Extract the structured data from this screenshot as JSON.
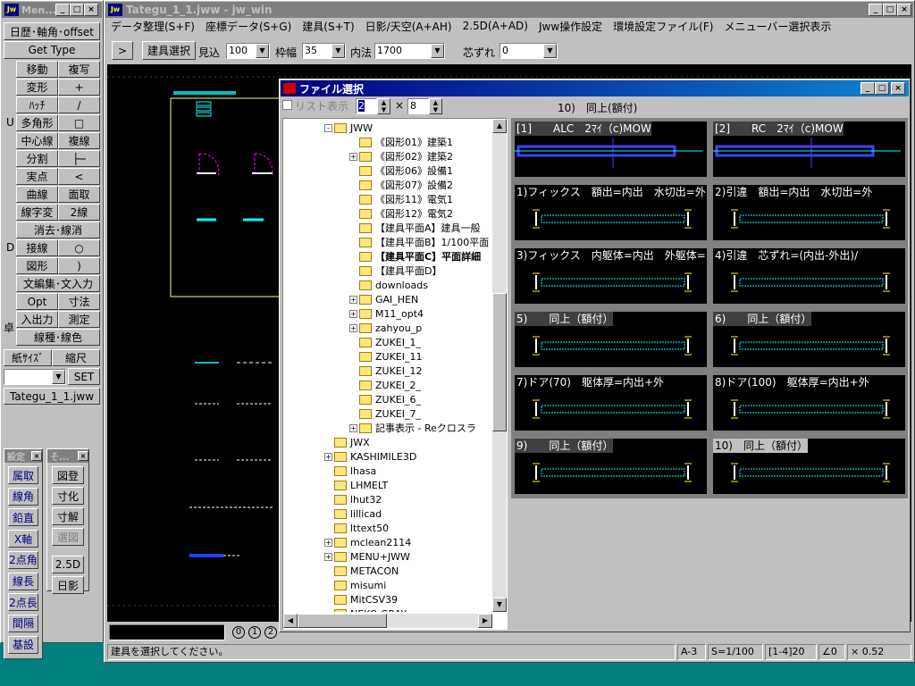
{
  "side": {
    "title": "Men...",
    "row1": "日歴･軸角･offset",
    "gettype": "Get Type",
    "tools": [
      [
        "移動",
        "複写"
      ],
      [
        "変形",
        "+"
      ],
      [
        "ﾊｯﾁ",
        "/"
      ],
      [
        "多角形",
        "□"
      ],
      [
        "中心線",
        "複線"
      ],
      [
        "分割",
        "├─"
      ],
      [
        "実点",
        "<"
      ],
      [
        "曲線",
        "面取"
      ],
      [
        "線字変",
        "2線"
      ],
      [
        "消去･線消",
        ""
      ],
      [
        "接線",
        "○"
      ],
      [
        "図形",
        ")"
      ],
      [
        "文編集･文入力",
        ""
      ],
      [
        "Opt",
        "寸法"
      ],
      [
        "入出力",
        "測定"
      ],
      [
        "線種･線色",
        ""
      ]
    ],
    "letters": [
      "U",
      "D",
      "卓"
    ],
    "paper": "紙ｻｲｽﾞ",
    "scale": "縮尺",
    "set": "SET",
    "file": "Tategu_1_1.jww",
    "sp1_title": "設定",
    "sp1": [
      "属取",
      "線角",
      "鉛直",
      "X軸",
      "2点角",
      "線長",
      "2点長",
      "間隔",
      "基設"
    ],
    "sp2_title": "そ...",
    "sp2": [
      "図登",
      "寸化",
      "寸解",
      "選図",
      "2.5D",
      "日影"
    ]
  },
  "main": {
    "title": "Tategu_1_1.jww - jw_win",
    "menu": [
      "データ整理(S+F)",
      "座標データ(S+G)",
      "建具(S+T)",
      "日影/天空(A+AH)",
      "2.5D(A+AD)",
      "Jww操作設定",
      "環境設定ファイル(F)",
      "メニューバー選択表示"
    ],
    "tb": {
      "arrow": ">",
      "sel": "建具選択",
      "mikomi": "見込",
      "mikomi_v": "100",
      "waku": "枠幅",
      "waku_v": "35",
      "uchi": "内法",
      "uchi_v": "1700",
      "shin": "芯ずれ",
      "shin_v": "0"
    },
    "circles": [
      "0",
      "1",
      "2"
    ],
    "status": {
      "msg": "建具を選択してください。",
      "paper": "A-3",
      "scale": "S=1/100",
      "layer": "[1-4]20",
      "angle": "∠0",
      "ratio": "× 0.52"
    }
  },
  "dlg": {
    "title": "ファイル選択",
    "list_label": "リスト表示",
    "cols": "2",
    "x": "×",
    "rows": "8",
    "selected": "10)　同上(額付)",
    "tree": [
      {
        "t": "JWW",
        "lv": 1,
        "exp": "-"
      },
      {
        "t": "《図形01》建築1",
        "lv": 2
      },
      {
        "t": "《図形02》建築2",
        "lv": 2,
        "exp": "+"
      },
      {
        "t": "《図形06》設備1",
        "lv": 2
      },
      {
        "t": "《図形07》設備2",
        "lv": 2
      },
      {
        "t": "《図形11》電気1",
        "lv": 2
      },
      {
        "t": "《図形12》電気2",
        "lv": 2
      },
      {
        "t": "【建具平面A】建具一般",
        "lv": 2
      },
      {
        "t": "【建具平面B】1/100平面",
        "lv": 2
      },
      {
        "t": "【建具平面C】平面詳細",
        "lv": 2,
        "bold": true
      },
      {
        "t": "【建具平面D】",
        "lv": 2
      },
      {
        "t": "downloads",
        "lv": 2
      },
      {
        "t": "GAI_HEN",
        "lv": 2,
        "exp": "+"
      },
      {
        "t": "M11_opt4",
        "lv": 2,
        "exp": "+"
      },
      {
        "t": "zahyou_p",
        "lv": 2,
        "exp": "+"
      },
      {
        "t": "ZUKEI_1_",
        "lv": 2
      },
      {
        "t": "ZUKEI_11",
        "lv": 2
      },
      {
        "t": "ZUKEI_12",
        "lv": 2
      },
      {
        "t": "ZUKEI_2_",
        "lv": 2
      },
      {
        "t": "ZUKEI_6_",
        "lv": 2
      },
      {
        "t": "ZUKEI_7_",
        "lv": 2
      },
      {
        "t": "記事表示 - Reクロスラ",
        "lv": 2,
        "exp": "+"
      },
      {
        "t": "JWX",
        "lv": 1
      },
      {
        "t": "KASHIMILE3D",
        "lv": 1,
        "exp": "+"
      },
      {
        "t": "lhasa",
        "lv": 1
      },
      {
        "t": "LHMELT",
        "lv": 1
      },
      {
        "t": "lhut32",
        "lv": 1
      },
      {
        "t": "lillicad",
        "lv": 1
      },
      {
        "t": "lttext50",
        "lv": 1
      },
      {
        "t": "mclean2114",
        "lv": 1,
        "exp": "+"
      },
      {
        "t": "MENU+JWW",
        "lv": 1,
        "exp": "+"
      },
      {
        "t": "METACON",
        "lv": 1
      },
      {
        "t": "misumi",
        "lv": 1
      },
      {
        "t": "MitCSV39",
        "lv": 1
      },
      {
        "t": "NEKO GRAY",
        "lv": 1
      }
    ],
    "cells": [
      {
        "cap": "[1]　　ALC　2ﾏｲ（c)MOW",
        "s": "dk"
      },
      {
        "cap": "[2]　　RC　2ﾏｲ（c)MOW",
        "s": "dk"
      },
      {
        "cap": "1)フィックス　額出=内出　水切出=外",
        "s": ""
      },
      {
        "cap": "2)引違　額出=内出　水切出=外",
        "s": ""
      },
      {
        "cap": "3)フィックス　内躯体=内出　外躯体=",
        "s": ""
      },
      {
        "cap": "4)引違　芯ずれ=(内出-外出)/",
        "s": ""
      },
      {
        "cap": "5)　　同上（額付）",
        "s": "dk"
      },
      {
        "cap": "6)　　同上（額付）",
        "s": "dk"
      },
      {
        "cap": "7)ドア(70)　躯体厚=内出+外",
        "s": ""
      },
      {
        "cap": "8)ドア(100)　躯体厚=内出+外",
        "s": ""
      },
      {
        "cap": "9)　　同上（額付）",
        "s": "dk"
      },
      {
        "cap": "10)　同上（額付）",
        "s": "hl"
      }
    ]
  },
  "colors": {
    "title": "#000080",
    "teal": "#008080"
  }
}
